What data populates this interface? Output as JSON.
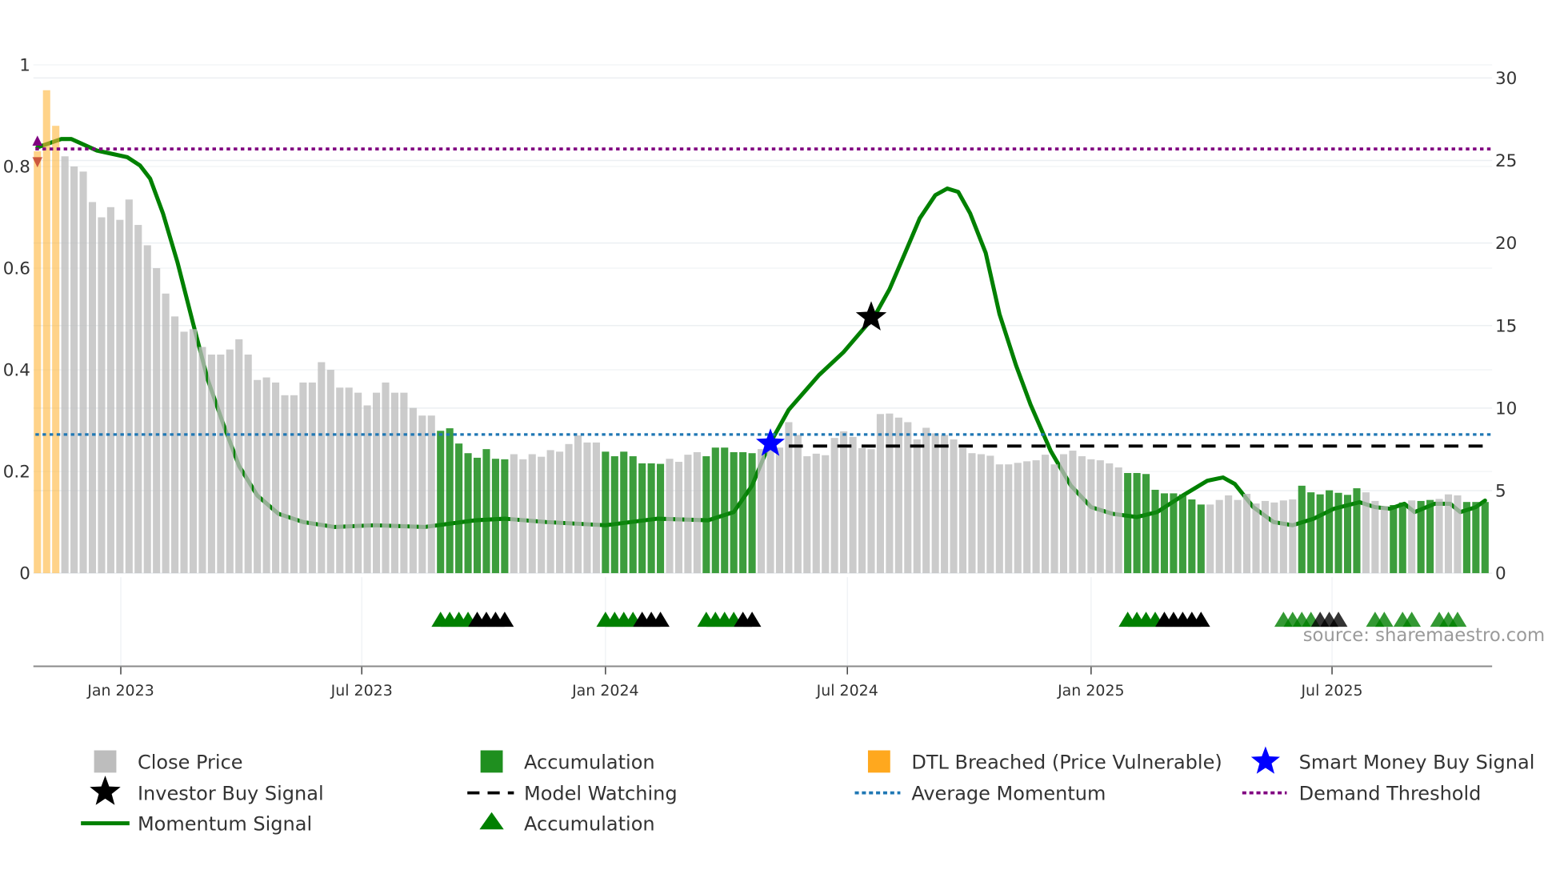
{
  "chart_data": {
    "type": "bar",
    "title": "",
    "source_note": "source: sharemaestro.com",
    "left_axis": {
      "label": "",
      "ylim": [
        0,
        1
      ],
      "ticks": [
        "0",
        "0.2",
        "0.4",
        "0.6",
        "0.8",
        "1"
      ],
      "tick_values": [
        0,
        0.2,
        0.4,
        0.6,
        0.8,
        1
      ]
    },
    "right_axis": {
      "label": "",
      "ylim": [
        0,
        30
      ],
      "ticks": [
        "0",
        "5",
        "10",
        "15",
        "20",
        "25",
        "30"
      ],
      "tick_values": [
        0,
        5,
        10,
        15,
        20,
        25,
        30
      ]
    },
    "x_axis": {
      "ticks": [
        "Jan 2023",
        "Jul 2023",
        "Jan 2024",
        "Jul 2024",
        "Jan 2025",
        "Jul 2025"
      ],
      "tick_bar_index": [
        10.1,
        36.4,
        63,
        89.4,
        116,
        142.3
      ]
    },
    "close_price": [
      0.83,
      0.95,
      0.88,
      0.82,
      0.8,
      0.79,
      0.73,
      0.7,
      0.72,
      0.695,
      0.735,
      0.685,
      0.645,
      0.6,
      0.55,
      0.505,
      0.475,
      0.48,
      0.445,
      0.43,
      0.43,
      0.44,
      0.46,
      0.43,
      0.38,
      0.385,
      0.375,
      0.35,
      0.35,
      0.375,
      0.375,
      0.415,
      0.4,
      0.365,
      0.365,
      0.355,
      0.33,
      0.355,
      0.375,
      0.355,
      0.355,
      0.325,
      0.31,
      0.31,
      0.28,
      0.285,
      0.255,
      0.236,
      0.227,
      0.244,
      0.225,
      0.224,
      0.234,
      0.224,
      0.234,
      0.229,
      0.242,
      0.239,
      0.254,
      0.271,
      0.257,
      0.257,
      0.239,
      0.23,
      0.239,
      0.23,
      0.216,
      0.216,
      0.215,
      0.225,
      0.219,
      0.233,
      0.238,
      0.23,
      0.247,
      0.247,
      0.238,
      0.238,
      0.236,
      0.244,
      0.254,
      0.247,
      0.297,
      0.272,
      0.23,
      0.235,
      0.232,
      0.266,
      0.279,
      0.268,
      0.246,
      0.244,
      0.313,
      0.314,
      0.306,
      0.297,
      0.263,
      0.286,
      0.275,
      0.272,
      0.263,
      0.246,
      0.236,
      0.234,
      0.231,
      0.214,
      0.214,
      0.217,
      0.22,
      0.222,
      0.233,
      0.214,
      0.234,
      0.241,
      0.23,
      0.224,
      0.222,
      0.216,
      0.208,
      0.197,
      0.197,
      0.195,
      0.164,
      0.157,
      0.157,
      0.155,
      0.145,
      0.135,
      0.135,
      0.144,
      0.153,
      0.144,
      0.156,
      0.137,
      0.142,
      0.139,
      0.143,
      0.145,
      0.172,
      0.159,
      0.155,
      0.163,
      0.158,
      0.154,
      0.167,
      0.159,
      0.142,
      0.132,
      0.134,
      0.139,
      0.143,
      0.142,
      0.144,
      0.146,
      0.155,
      0.153,
      0.14,
      0.14,
      0.14
    ],
    "accumulation_ranges": [
      [
        45,
        52
      ],
      [
        63,
        69
      ],
      [
        74,
        79
      ],
      [
        120,
        128
      ],
      [
        139,
        145
      ],
      [
        149,
        150
      ],
      [
        152,
        153
      ],
      [
        157,
        159
      ]
    ],
    "dtl_breached_indices": [
      1,
      2,
      3
    ],
    "momentum_signal": [
      [
        1,
        25.8
      ],
      [
        3.6,
        26.3
      ],
      [
        4.7,
        26.3
      ],
      [
        7.5,
        25.6
      ],
      [
        10.8,
        25.2
      ],
      [
        12.2,
        24.7
      ],
      [
        13.3,
        23.9
      ],
      [
        14.7,
        21.8
      ],
      [
        16.3,
        18.8
      ],
      [
        18,
        15.1
      ],
      [
        19.6,
        11.7
      ],
      [
        21.3,
        9
      ],
      [
        23,
        6.5
      ],
      [
        25,
        4.7
      ],
      [
        27.3,
        3.6
      ],
      [
        30,
        3.1
      ],
      [
        33.4,
        2.8
      ],
      [
        37.8,
        2.9
      ],
      [
        43.3,
        2.8
      ],
      [
        48.8,
        3.2
      ],
      [
        52,
        3.3
      ],
      [
        56.5,
        3.1
      ],
      [
        63,
        2.9
      ],
      [
        68.7,
        3.3
      ],
      [
        74.2,
        3.2
      ],
      [
        77,
        3.7
      ],
      [
        79,
        5.3
      ],
      [
        80.8,
        7.7
      ],
      [
        83,
        9.9
      ],
      [
        86.3,
        12
      ],
      [
        89,
        13.4
      ],
      [
        90.7,
        14.5
      ],
      [
        92.4,
        15.6
      ],
      [
        94,
        17.2
      ],
      [
        95.7,
        19.4
      ],
      [
        97.3,
        21.5
      ],
      [
        99,
        22.9
      ],
      [
        100.3,
        23.3
      ],
      [
        101.5,
        23.1
      ],
      [
        102.8,
        21.8
      ],
      [
        104.5,
        19.4
      ],
      [
        106,
        15.7
      ],
      [
        107.8,
        12.6
      ],
      [
        109.4,
        10.2
      ],
      [
        111.6,
        7.4
      ],
      [
        113.8,
        5.3
      ],
      [
        116,
        4
      ],
      [
        118.3,
        3.6
      ],
      [
        121,
        3.4
      ],
      [
        123.2,
        3.7
      ],
      [
        126,
        4.7
      ],
      [
        128.7,
        5.6
      ],
      [
        130.4,
        5.8
      ],
      [
        131.7,
        5.4
      ],
      [
        133.7,
        4
      ],
      [
        135.9,
        3.1
      ],
      [
        138,
        2.9
      ],
      [
        140.3,
        3.3
      ],
      [
        142.5,
        3.9
      ],
      [
        145.3,
        4.3
      ],
      [
        147,
        4
      ],
      [
        148.6,
        3.9
      ],
      [
        150.2,
        4.2
      ],
      [
        151.3,
        3.7
      ],
      [
        153.5,
        4.2
      ],
      [
        155.2,
        4.2
      ],
      [
        156.3,
        3.7
      ],
      [
        158,
        4
      ],
      [
        159,
        4.4
      ]
    ],
    "demand_threshold": 25.7,
    "average_momentum": 8.4,
    "model_watching": {
      "value": 7.7,
      "from_index": 83,
      "to_index": 159
    },
    "smart_money_buy_signal": {
      "index": 81,
      "value": 7.85
    },
    "investor_buy_signal": {
      "index": 92,
      "value": 15.5
    },
    "accumulation_triangles_green": [
      45,
      46,
      47,
      48,
      63,
      64,
      65,
      66,
      74,
      75,
      76,
      77,
      120,
      121,
      122,
      123,
      137,
      138,
      139,
      140,
      147,
      148,
      150,
      151,
      154,
      155,
      156
    ],
    "accumulation_triangles_black": [
      49,
      50,
      51,
      52,
      67,
      68,
      69,
      78,
      79,
      124,
      125,
      126,
      127,
      128,
      141,
      142,
      143
    ],
    "legend": [
      {
        "label": "Close Price",
        "icon": "grey-square",
        "color": "#bdbdbd"
      },
      {
        "label": "Accumulation",
        "icon": "green-square",
        "color": "#1f8f1f"
      },
      {
        "label": "DTL Breached (Price Vulnerable)",
        "icon": "orange-square",
        "color": "#ffa81e"
      },
      {
        "label": "Smart Money Buy Signal",
        "icon": "blue-star",
        "color": "#0000ff"
      },
      {
        "label": "Investor Buy Signal",
        "icon": "black-star",
        "color": "#000000"
      },
      {
        "label": "Model Watching",
        "icon": "dashed-line",
        "color": "#000000"
      },
      {
        "label": "Average Momentum",
        "icon": "dotted-line",
        "color": "#1f77b4"
      },
      {
        "label": "Demand Threshold",
        "icon": "dotted-line",
        "color": "#800080"
      },
      {
        "label": "Momentum Signal",
        "icon": "solid-line",
        "color": "#008000"
      },
      {
        "label": "Accumulation",
        "icon": "green-triangle",
        "color": "#008000"
      }
    ]
  }
}
